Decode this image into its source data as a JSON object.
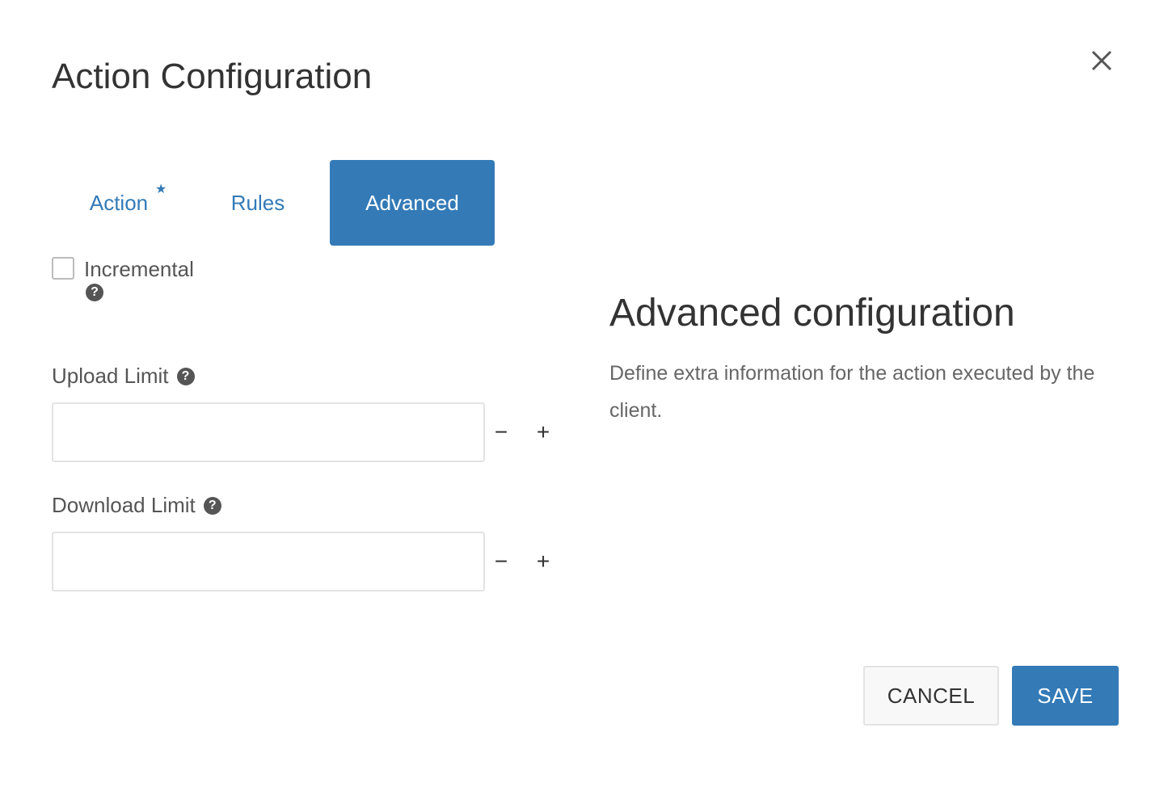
{
  "dialog": {
    "title": "Action Configuration",
    "close_icon": "close-icon"
  },
  "tabs": [
    {
      "label": "Action",
      "required_marker": "*",
      "active": false
    },
    {
      "label": "Rules",
      "active": false
    },
    {
      "label": "Advanced",
      "active": true
    }
  ],
  "form": {
    "incremental": {
      "label": "Incremental",
      "checked": false,
      "help": "?"
    },
    "upload_limit": {
      "label": "Upload Limit",
      "help": "?",
      "value": "",
      "decrement": "−",
      "increment": "+"
    },
    "download_limit": {
      "label": "Download Limit",
      "help": "?",
      "value": "",
      "decrement": "−",
      "increment": "+"
    }
  },
  "side_panel": {
    "title": "Advanced configuration",
    "description": "Define extra information for the action executed by the client."
  },
  "footer": {
    "cancel_label": "CANCEL",
    "save_label": "SAVE"
  },
  "colors": {
    "accent": "#337ab7",
    "text": "#333333",
    "muted": "#555555"
  }
}
